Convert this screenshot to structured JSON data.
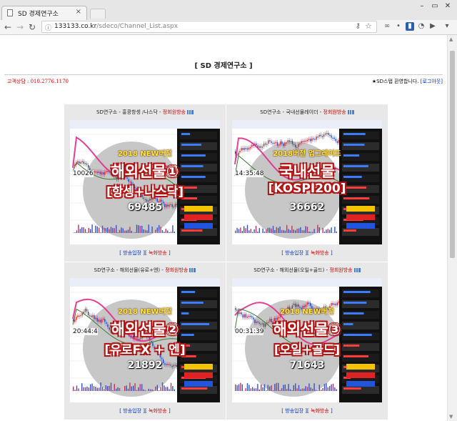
{
  "browser": {
    "tab_title": "SD 경제연구소",
    "tab_close": "×",
    "url_host": "133133.co.kr",
    "url_path": "/sdeco/Channel_List.aspx",
    "window_controls": [
      "–",
      "▭",
      "✕"
    ]
  },
  "page": {
    "title": "[ SD 경제연구소 ]",
    "contact": "고객상담 : 010.2776.1170",
    "welcome": "★SD스탭 환영합니다.",
    "logout_open": "[",
    "logout_label": "로그아웃",
    "logout_close": "]"
  },
  "channels": [
    {
      "name": "SD연구소 - 홍콩항셍 /나스닥",
      "live": "정회원방송",
      "edition": "2018 NEW버전",
      "main": "해외선물①",
      "sub": "[항셍+나스닥]",
      "count": "69485",
      "enter": "방송입장",
      "record": "녹화방송",
      "price_label": "10026"
    },
    {
      "name": "SD연구소 - 국내선물레이더",
      "live": "정회원방송",
      "edition": "2018버전 업그레이드",
      "main": "국내선물",
      "sub": "[KOSPI200]",
      "count": "36662",
      "enter": "방송입장",
      "record": "녹화방송",
      "price_label": "14:35:48"
    },
    {
      "name": "SD연구소 - 해외선물(유로+엔)",
      "live": "정회원방송",
      "edition": "2018 NEW버전",
      "main": "해외선물②",
      "sub": "[유로FX + 엔]",
      "count": "21892",
      "enter": "방송입장",
      "record": "녹화방송",
      "price_label": "20:44:4"
    },
    {
      "name": "SD연구소 - 해외선물(오일+골드)",
      "live": "정회원방송",
      "edition": "2018 NEW버전",
      "main": "해외선물③",
      "sub": "[오일+골드]",
      "count": "71643",
      "enter": "방송입장",
      "record": "녹화방송",
      "price_label": "00:31:39"
    }
  ],
  "icons": {
    "back": "back-arrow-icon",
    "forward": "forward-arrow-icon",
    "reload": "reload-icon",
    "info": "info-icon",
    "key": "key-icon",
    "star": "bookmark-star-icon",
    "live": "live-broadcast-icon"
  },
  "colors": {
    "contact_red": "#e00000",
    "live_red": "#cc0000",
    "link_blue": "#0033cc",
    "card_bg": "#e8e8e8"
  }
}
